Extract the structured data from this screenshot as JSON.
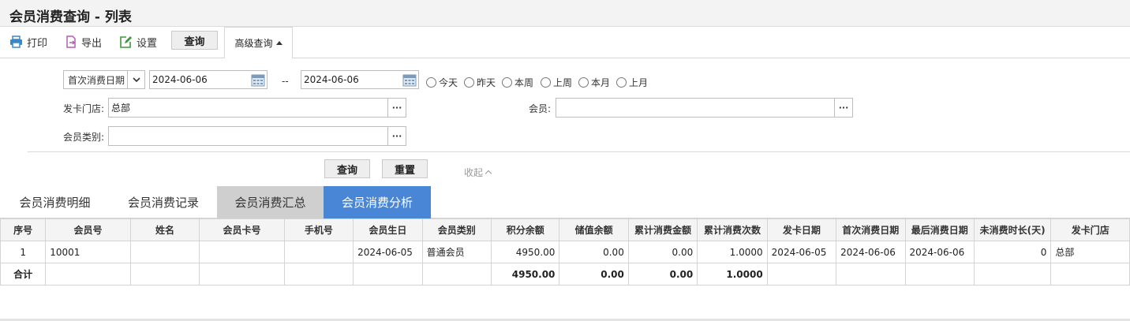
{
  "page_title": "会员消费查询 - 列表",
  "toolbar": {
    "print_label": "打印",
    "export_label": "导出",
    "settings_label": "设置",
    "query_label": "查询",
    "advanced_label": "高级查询"
  },
  "filters": {
    "date_type": "首次消费日期",
    "date_from": "2024-06-06",
    "date_sep": "--",
    "date_to": "2024-06-06",
    "quick_ranges": [
      "今天",
      "昨天",
      "本周",
      "上周",
      "本月",
      "上月"
    ],
    "store_label": "发卡门店:",
    "store_value": "总部",
    "member_label": "会员:",
    "member_value": "",
    "category_label": "会员类别:",
    "category_value": "",
    "more_glyph": "···",
    "search_label": "查询",
    "reset_label": "重置",
    "collapse_label": "收起"
  },
  "tabs": [
    {
      "label": "会员消费明细",
      "state": "normal"
    },
    {
      "label": "会员消费记录",
      "state": "normal"
    },
    {
      "label": "会员消费汇总",
      "state": "gray"
    },
    {
      "label": "会员消费分析",
      "state": "active"
    }
  ],
  "table": {
    "columns": [
      "序号",
      "会员号",
      "姓名",
      "会员卡号",
      "手机号",
      "会员生日",
      "会员类别",
      "积分余额",
      "储值余额",
      "累计消费金额",
      "累计消费次数",
      "发卡日期",
      "首次消费日期",
      "最后消费日期",
      "未消费时长(天)",
      "发卡门店"
    ],
    "rows": [
      [
        "1",
        "10001",
        "",
        "",
        "",
        "2024-06-05",
        "普通会员",
        "4950.00",
        "0.00",
        "0.00",
        "1.0000",
        "2024-06-05",
        "2024-06-06",
        "2024-06-06",
        "0",
        "总部"
      ]
    ],
    "total": [
      "合计",
      "",
      "",
      "",
      "",
      "",
      "",
      "4950.00",
      "0.00",
      "0.00",
      "1.0000",
      "",
      "",
      "",
      "",
      ""
    ]
  },
  "colors": {
    "accent": "#4a86d6",
    "tab_gray": "#cfcfcf",
    "header_bg": "#f4f4f4"
  },
  "icons": {
    "print": "printer-icon",
    "export": "export-icon",
    "settings": "edit-icon",
    "calendar": "calendar-icon"
  }
}
